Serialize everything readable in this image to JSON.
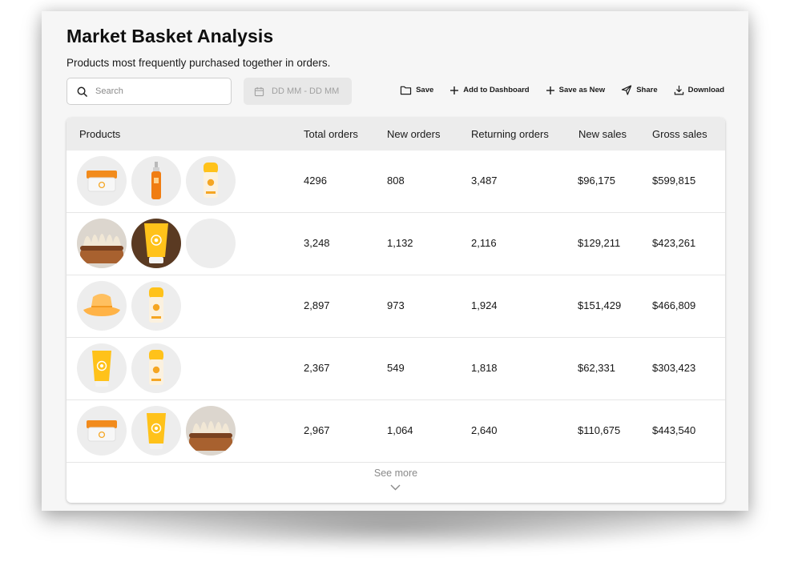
{
  "header": {
    "title": "Market Basket Analysis",
    "subtitle": "Products most frequently purchased together in orders."
  },
  "search": {
    "placeholder": "Search",
    "value": ""
  },
  "date_range": {
    "placeholder": "DD MM - DD MM"
  },
  "toolbar": {
    "save_label": "Save",
    "add_dashboard_label": "Add to Dashboard",
    "save_new_label": "Save as New",
    "share_label": "Share",
    "download_label": "Download"
  },
  "table": {
    "columns": [
      "Products",
      "Total orders",
      "New orders",
      "Returning orders",
      "New sales",
      "Gross sales"
    ],
    "rows": [
      {
        "products": [
          "cream-jar-icon",
          "spray-bottle-icon",
          "sunscreen-stick-icon"
        ],
        "total_orders": "4296",
        "new_orders": "808",
        "returning_orders": "3,487",
        "new_sales": "$96,175",
        "gross_sales": "$599,815"
      },
      {
        "products": [
          "brush-icon",
          "sunscreen-tube-icon",
          "empty-thumb"
        ],
        "total_orders": "3,248",
        "new_orders": "1,132",
        "returning_orders": "2,116",
        "new_sales": "$129,211",
        "gross_sales": "$423,261"
      },
      {
        "products": [
          "bucket-hat-icon",
          "sunscreen-stick-icon"
        ],
        "total_orders": "2,897",
        "new_orders": "973",
        "returning_orders": "1,924",
        "new_sales": "$151,429",
        "gross_sales": "$466,809"
      },
      {
        "products": [
          "sunscreen-tube-icon",
          "sunscreen-stick-icon"
        ],
        "total_orders": "2,367",
        "new_orders": "549",
        "returning_orders": "1,818",
        "new_sales": "$62,331",
        "gross_sales": "$303,423"
      },
      {
        "products": [
          "cream-jar-icon",
          "sunscreen-tube-icon",
          "brush-icon"
        ],
        "total_orders": "2,967",
        "new_orders": "1,064",
        "returning_orders": "2,640",
        "new_sales": "$110,675",
        "gross_sales": "$443,540"
      }
    ],
    "see_more_label": "See more"
  },
  "colors": {
    "accent_orange": "#f5a623",
    "accent_yellow": "#ffc21a",
    "header_bg": "#ececec"
  }
}
